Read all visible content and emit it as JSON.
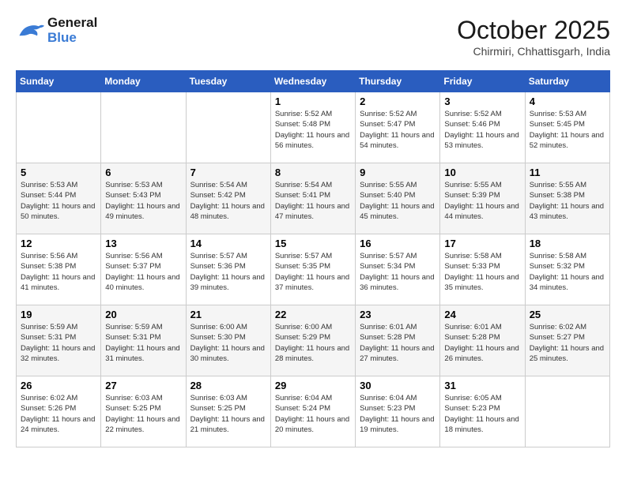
{
  "header": {
    "logo_line1": "General",
    "logo_line2": "Blue",
    "month_title": "October 2025",
    "subtitle": "Chirmiri, Chhattisgarh, India"
  },
  "weekdays": [
    "Sunday",
    "Monday",
    "Tuesday",
    "Wednesday",
    "Thursday",
    "Friday",
    "Saturday"
  ],
  "weeks": [
    [
      {
        "day": "",
        "sunrise": "",
        "sunset": "",
        "daylight": ""
      },
      {
        "day": "",
        "sunrise": "",
        "sunset": "",
        "daylight": ""
      },
      {
        "day": "",
        "sunrise": "",
        "sunset": "",
        "daylight": ""
      },
      {
        "day": "1",
        "sunrise": "Sunrise: 5:52 AM",
        "sunset": "Sunset: 5:48 PM",
        "daylight": "Daylight: 11 hours and 56 minutes."
      },
      {
        "day": "2",
        "sunrise": "Sunrise: 5:52 AM",
        "sunset": "Sunset: 5:47 PM",
        "daylight": "Daylight: 11 hours and 54 minutes."
      },
      {
        "day": "3",
        "sunrise": "Sunrise: 5:52 AM",
        "sunset": "Sunset: 5:46 PM",
        "daylight": "Daylight: 11 hours and 53 minutes."
      },
      {
        "day": "4",
        "sunrise": "Sunrise: 5:53 AM",
        "sunset": "Sunset: 5:45 PM",
        "daylight": "Daylight: 11 hours and 52 minutes."
      }
    ],
    [
      {
        "day": "5",
        "sunrise": "Sunrise: 5:53 AM",
        "sunset": "Sunset: 5:44 PM",
        "daylight": "Daylight: 11 hours and 50 minutes."
      },
      {
        "day": "6",
        "sunrise": "Sunrise: 5:53 AM",
        "sunset": "Sunset: 5:43 PM",
        "daylight": "Daylight: 11 hours and 49 minutes."
      },
      {
        "day": "7",
        "sunrise": "Sunrise: 5:54 AM",
        "sunset": "Sunset: 5:42 PM",
        "daylight": "Daylight: 11 hours and 48 minutes."
      },
      {
        "day": "8",
        "sunrise": "Sunrise: 5:54 AM",
        "sunset": "Sunset: 5:41 PM",
        "daylight": "Daylight: 11 hours and 47 minutes."
      },
      {
        "day": "9",
        "sunrise": "Sunrise: 5:55 AM",
        "sunset": "Sunset: 5:40 PM",
        "daylight": "Daylight: 11 hours and 45 minutes."
      },
      {
        "day": "10",
        "sunrise": "Sunrise: 5:55 AM",
        "sunset": "Sunset: 5:39 PM",
        "daylight": "Daylight: 11 hours and 44 minutes."
      },
      {
        "day": "11",
        "sunrise": "Sunrise: 5:55 AM",
        "sunset": "Sunset: 5:38 PM",
        "daylight": "Daylight: 11 hours and 43 minutes."
      }
    ],
    [
      {
        "day": "12",
        "sunrise": "Sunrise: 5:56 AM",
        "sunset": "Sunset: 5:38 PM",
        "daylight": "Daylight: 11 hours and 41 minutes."
      },
      {
        "day": "13",
        "sunrise": "Sunrise: 5:56 AM",
        "sunset": "Sunset: 5:37 PM",
        "daylight": "Daylight: 11 hours and 40 minutes."
      },
      {
        "day": "14",
        "sunrise": "Sunrise: 5:57 AM",
        "sunset": "Sunset: 5:36 PM",
        "daylight": "Daylight: 11 hours and 39 minutes."
      },
      {
        "day": "15",
        "sunrise": "Sunrise: 5:57 AM",
        "sunset": "Sunset: 5:35 PM",
        "daylight": "Daylight: 11 hours and 37 minutes."
      },
      {
        "day": "16",
        "sunrise": "Sunrise: 5:57 AM",
        "sunset": "Sunset: 5:34 PM",
        "daylight": "Daylight: 11 hours and 36 minutes."
      },
      {
        "day": "17",
        "sunrise": "Sunrise: 5:58 AM",
        "sunset": "Sunset: 5:33 PM",
        "daylight": "Daylight: 11 hours and 35 minutes."
      },
      {
        "day": "18",
        "sunrise": "Sunrise: 5:58 AM",
        "sunset": "Sunset: 5:32 PM",
        "daylight": "Daylight: 11 hours and 34 minutes."
      }
    ],
    [
      {
        "day": "19",
        "sunrise": "Sunrise: 5:59 AM",
        "sunset": "Sunset: 5:31 PM",
        "daylight": "Daylight: 11 hours and 32 minutes."
      },
      {
        "day": "20",
        "sunrise": "Sunrise: 5:59 AM",
        "sunset": "Sunset: 5:31 PM",
        "daylight": "Daylight: 11 hours and 31 minutes."
      },
      {
        "day": "21",
        "sunrise": "Sunrise: 6:00 AM",
        "sunset": "Sunset: 5:30 PM",
        "daylight": "Daylight: 11 hours and 30 minutes."
      },
      {
        "day": "22",
        "sunrise": "Sunrise: 6:00 AM",
        "sunset": "Sunset: 5:29 PM",
        "daylight": "Daylight: 11 hours and 28 minutes."
      },
      {
        "day": "23",
        "sunrise": "Sunrise: 6:01 AM",
        "sunset": "Sunset: 5:28 PM",
        "daylight": "Daylight: 11 hours and 27 minutes."
      },
      {
        "day": "24",
        "sunrise": "Sunrise: 6:01 AM",
        "sunset": "Sunset: 5:28 PM",
        "daylight": "Daylight: 11 hours and 26 minutes."
      },
      {
        "day": "25",
        "sunrise": "Sunrise: 6:02 AM",
        "sunset": "Sunset: 5:27 PM",
        "daylight": "Daylight: 11 hours and 25 minutes."
      }
    ],
    [
      {
        "day": "26",
        "sunrise": "Sunrise: 6:02 AM",
        "sunset": "Sunset: 5:26 PM",
        "daylight": "Daylight: 11 hours and 24 minutes."
      },
      {
        "day": "27",
        "sunrise": "Sunrise: 6:03 AM",
        "sunset": "Sunset: 5:25 PM",
        "daylight": "Daylight: 11 hours and 22 minutes."
      },
      {
        "day": "28",
        "sunrise": "Sunrise: 6:03 AM",
        "sunset": "Sunset: 5:25 PM",
        "daylight": "Daylight: 11 hours and 21 minutes."
      },
      {
        "day": "29",
        "sunrise": "Sunrise: 6:04 AM",
        "sunset": "Sunset: 5:24 PM",
        "daylight": "Daylight: 11 hours and 20 minutes."
      },
      {
        "day": "30",
        "sunrise": "Sunrise: 6:04 AM",
        "sunset": "Sunset: 5:23 PM",
        "daylight": "Daylight: 11 hours and 19 minutes."
      },
      {
        "day": "31",
        "sunrise": "Sunrise: 6:05 AM",
        "sunset": "Sunset: 5:23 PM",
        "daylight": "Daylight: 11 hours and 18 minutes."
      },
      {
        "day": "",
        "sunrise": "",
        "sunset": "",
        "daylight": ""
      }
    ]
  ]
}
